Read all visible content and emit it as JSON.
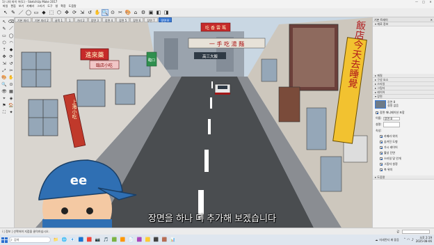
{
  "window": {
    "title": "1) 나의 파이 어(도) - SketchUp Make 2017",
    "buttons": [
      "—",
      "□",
      "✕"
    ]
  },
  "menu": [
    "파일",
    "편집",
    "보기",
    "카메라",
    "그리기",
    "도구",
    "창",
    "확장",
    "도움말"
  ],
  "toolbar_icons": [
    "↖",
    "✎",
    "／",
    "◯",
    "▭",
    "◆",
    "⬚",
    "⬡",
    "✥",
    "⟳",
    "⇲",
    "↺",
    "✋",
    "🔍",
    "⊙",
    "✂",
    "🎨",
    "⌂",
    "⚙",
    "▣",
    "◧",
    "◨"
  ],
  "palette_icons": [
    "↖",
    "⌫",
    "✎",
    "／",
    "▭",
    "◯",
    "⬡",
    "◠",
    "⇡",
    "◆",
    "✥",
    "⟳",
    "⇲",
    "↺",
    "⤢",
    "✂",
    "🎨",
    "✋",
    "🔍",
    "⊙",
    "👁",
    "▦",
    "⌖",
    "◈",
    "⚑",
    "🏠",
    "⛶",
    "✦"
  ],
  "scene_tabs": [
    {
      "label": "기본 미리",
      "active": false
    },
    {
      "label": "기본 미리 2",
      "active": false
    },
    {
      "label": "골목 1",
      "active": false
    },
    {
      "label": "1",
      "active": false
    },
    {
      "label": "거리 2",
      "active": false
    },
    {
      "label": "장면 3",
      "active": false
    },
    {
      "label": "장면 4",
      "active": false
    },
    {
      "label": "장면 5",
      "active": false
    },
    {
      "label": "장면 6",
      "active": false
    },
    {
      "label": "장면 7",
      "active": false
    },
    {
      "label": "장면 8",
      "active": true
    }
  ],
  "subtitle": "장면을 하나 더 추가해 보겠습니다",
  "signs": {
    "left_red": "進來藥",
    "left_pink": "臨店小吃",
    "top_1": "一 手 吃 湯 麵",
    "top_2": "吃 香 雲 瑪",
    "right_yellow": "飯店今天去睡覺",
    "left_vertical": "上海小吃",
    "green": "臨口",
    "mid": "高三大飯"
  },
  "tray": {
    "title": "기본 트레이",
    "sections_top": [
      "재료 정보"
    ],
    "sections": [
      "재질",
      "구성 요소",
      "스타일",
      "그림자",
      "레이어",
      "장면"
    ],
    "scene_name": "장면 8",
    "scene_desc": "설명 없음",
    "name_label": "이름:",
    "name_value": "장면 8",
    "desc_label": "설명:",
    "property_label": "속성:",
    "checks": [
      {
        "label": "카메라 위치",
        "on": true
      },
      {
        "label": "숨겨진 도형",
        "on": true
      },
      {
        "label": "가시 레이어",
        "on": true
      },
      {
        "label": "활성 단면",
        "on": true
      },
      {
        "label": "스타일 및 안개",
        "on": true
      },
      {
        "label": "그림자 설정",
        "on": true
      },
      {
        "label": "축 위치",
        "on": true
      }
    ],
    "include_label": "장면 애니메이션 포함",
    "bottom_section": "도움말"
  },
  "status": {
    "text": "i  | 정보 | 선택하여 지점을 클릭하십시오.",
    "measure_label": "값"
  },
  "taskbar": {
    "search_placeholder": "검색",
    "apps": [
      "📁",
      "🌐",
      "📧",
      "🟦",
      "🟥",
      "📷",
      "🎵",
      "🟩",
      "🟧",
      "📄",
      "🟪",
      "🟨",
      "⬛",
      "🟫",
      "📊"
    ],
    "weather": "미세먼지 꽤 좋음",
    "time": "오후 2:19",
    "date": "2025-08-06"
  },
  "colors": {
    "active_tab": "#3b7bd6",
    "road": "#4a4d50",
    "sidewalk": "#8a8d92",
    "sky": "#c9d7e3"
  }
}
